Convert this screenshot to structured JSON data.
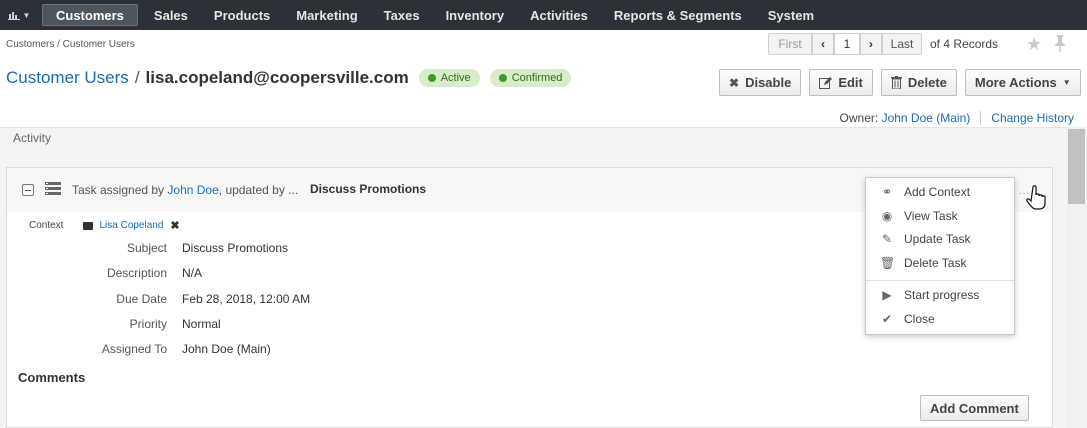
{
  "nav": {
    "items": [
      "Customers",
      "Sales",
      "Products",
      "Marketing",
      "Taxes",
      "Inventory",
      "Activities",
      "Reports & Segments",
      "System"
    ],
    "active": "Customers"
  },
  "breadcrumb": "Customers / Customer Users",
  "pager": {
    "first": "First",
    "page": "1",
    "last": "Last",
    "of_records": "of 4 Records"
  },
  "title": {
    "crumb": "Customer Users",
    "separator": "/",
    "record": "lisa.copeland@coopersville.com",
    "badges": [
      "Active",
      "Confirmed"
    ]
  },
  "actions": {
    "disable": "Disable",
    "edit": "Edit",
    "delete": "Delete",
    "more": "More Actions"
  },
  "owner": {
    "label": "Owner:",
    "name": "John Doe (Main)",
    "change_history": "Change History"
  },
  "activity": {
    "label": "Activity",
    "task": {
      "header_prefix": "Task assigned by",
      "assigned_by": "John Doe",
      "header_suffix": ", updated by ...",
      "subject_title": "Discuss Promotions",
      "context_label": "Context",
      "context_link": "Lisa Copeland",
      "fields": [
        {
          "label": "Subject",
          "value": "Discuss Promotions"
        },
        {
          "label": "Description",
          "value": "N/A"
        },
        {
          "label": "Due Date",
          "value": "Feb 28, 2018, 12:00 AM"
        },
        {
          "label": "Priority",
          "value": "Normal"
        },
        {
          "label": "Assigned To",
          "value": "John Doe (Main)"
        }
      ],
      "comments_title": "Comments",
      "add_comment": "Add Comment"
    }
  },
  "dropdown": {
    "items": [
      {
        "label": "Add Context",
        "icon": "link-icon"
      },
      {
        "label": "View Task",
        "icon": "eye-icon"
      },
      {
        "label": "Update Task",
        "icon": "edit-icon"
      },
      {
        "label": "Delete Task",
        "icon": "trash-icon"
      },
      {
        "label": "Start progress",
        "icon": "play-icon"
      },
      {
        "label": "Close",
        "icon": "check-icon"
      }
    ]
  }
}
